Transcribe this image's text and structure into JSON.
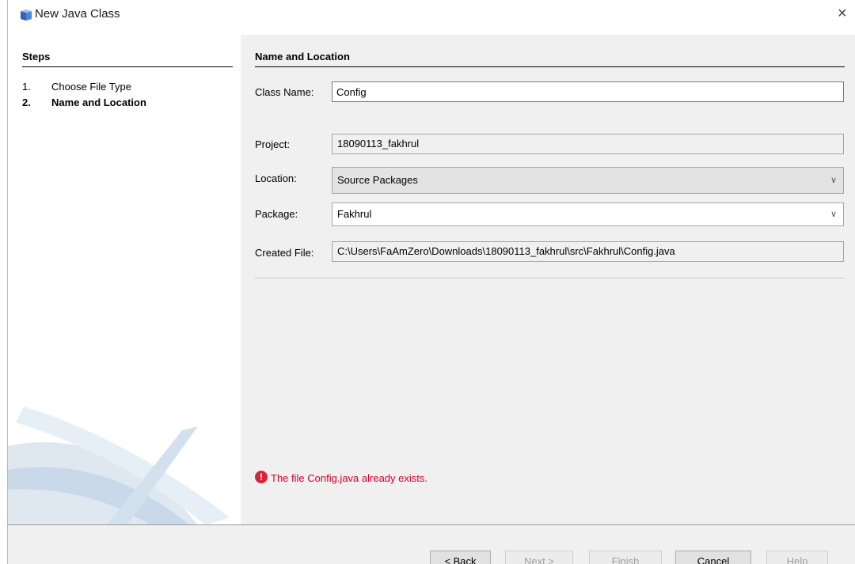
{
  "window": {
    "title": "New Java Class",
    "close_glyph": "×"
  },
  "steps": {
    "title": "Steps",
    "items": [
      {
        "num": "1.",
        "label": "Choose File Type"
      },
      {
        "num": "2.",
        "label": "Name and Location"
      }
    ]
  },
  "panel": {
    "title": "Name and Location",
    "class_name": {
      "label": "Class Name:",
      "value": "Config"
    },
    "project": {
      "label": "Project:",
      "value": "18090113_fakhrul"
    },
    "location": {
      "label": "Location:",
      "value": "Source Packages"
    },
    "package": {
      "label": "Package:",
      "value": "Fakhrul"
    },
    "created_file": {
      "label": "Created File:",
      "value": "C:\\Users\\FaAmZero\\Downloads\\18090113_fakhrul\\src\\Fakhrul\\Config.java"
    }
  },
  "error": {
    "icon": "!",
    "message": "The file Config.java already exists.",
    "color": "#d2002b"
  },
  "buttons": {
    "back": "< Back",
    "next": "Next >",
    "finish": "Finish",
    "cancel": "Cancel",
    "help": "Help"
  },
  "icons": {
    "window_icon": "java-class-icon",
    "close": "close-icon",
    "combo_arrow": "chevron-down-icon",
    "error": "error-icon"
  }
}
